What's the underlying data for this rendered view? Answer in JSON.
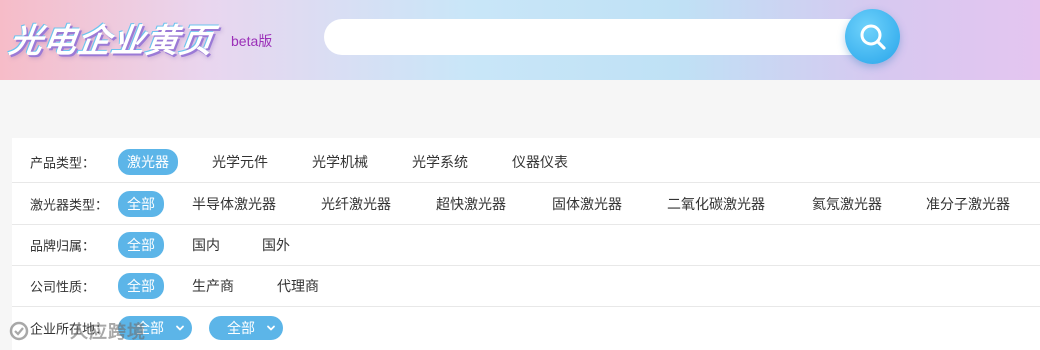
{
  "header": {
    "logo_text": "光电企业黄页",
    "badge": "beta版"
  },
  "search": {
    "value": "",
    "placeholder": ""
  },
  "filters": {
    "product_type": {
      "label": "产品类型：",
      "options": [
        "激光器",
        "光学元件",
        "光学机械",
        "光学系统",
        "仪器仪表"
      ],
      "selected": "激光器"
    },
    "laser_type": {
      "label": "激光器类型：",
      "options": [
        "全部",
        "半导体激光器",
        "光纤激光器",
        "超快激光器",
        "固体激光器",
        "二氧化碳激光器",
        "氦氖激光器",
        "准分子激光器"
      ],
      "selected": "全部"
    },
    "brand": {
      "label": "品牌归属：",
      "options": [
        "全部",
        "国内",
        "国外"
      ],
      "selected": "全部"
    },
    "company_nature": {
      "label": "公司性质：",
      "options": [
        "全部",
        "生产商",
        "代理商"
      ],
      "selected": "全部"
    },
    "location": {
      "label": "企业所在地：",
      "province": "全部",
      "city": "全部"
    }
  },
  "watermark": {
    "text": "人应跨境"
  },
  "colors": {
    "accent": "#5cb5e8",
    "badge": "#9b30b8"
  }
}
